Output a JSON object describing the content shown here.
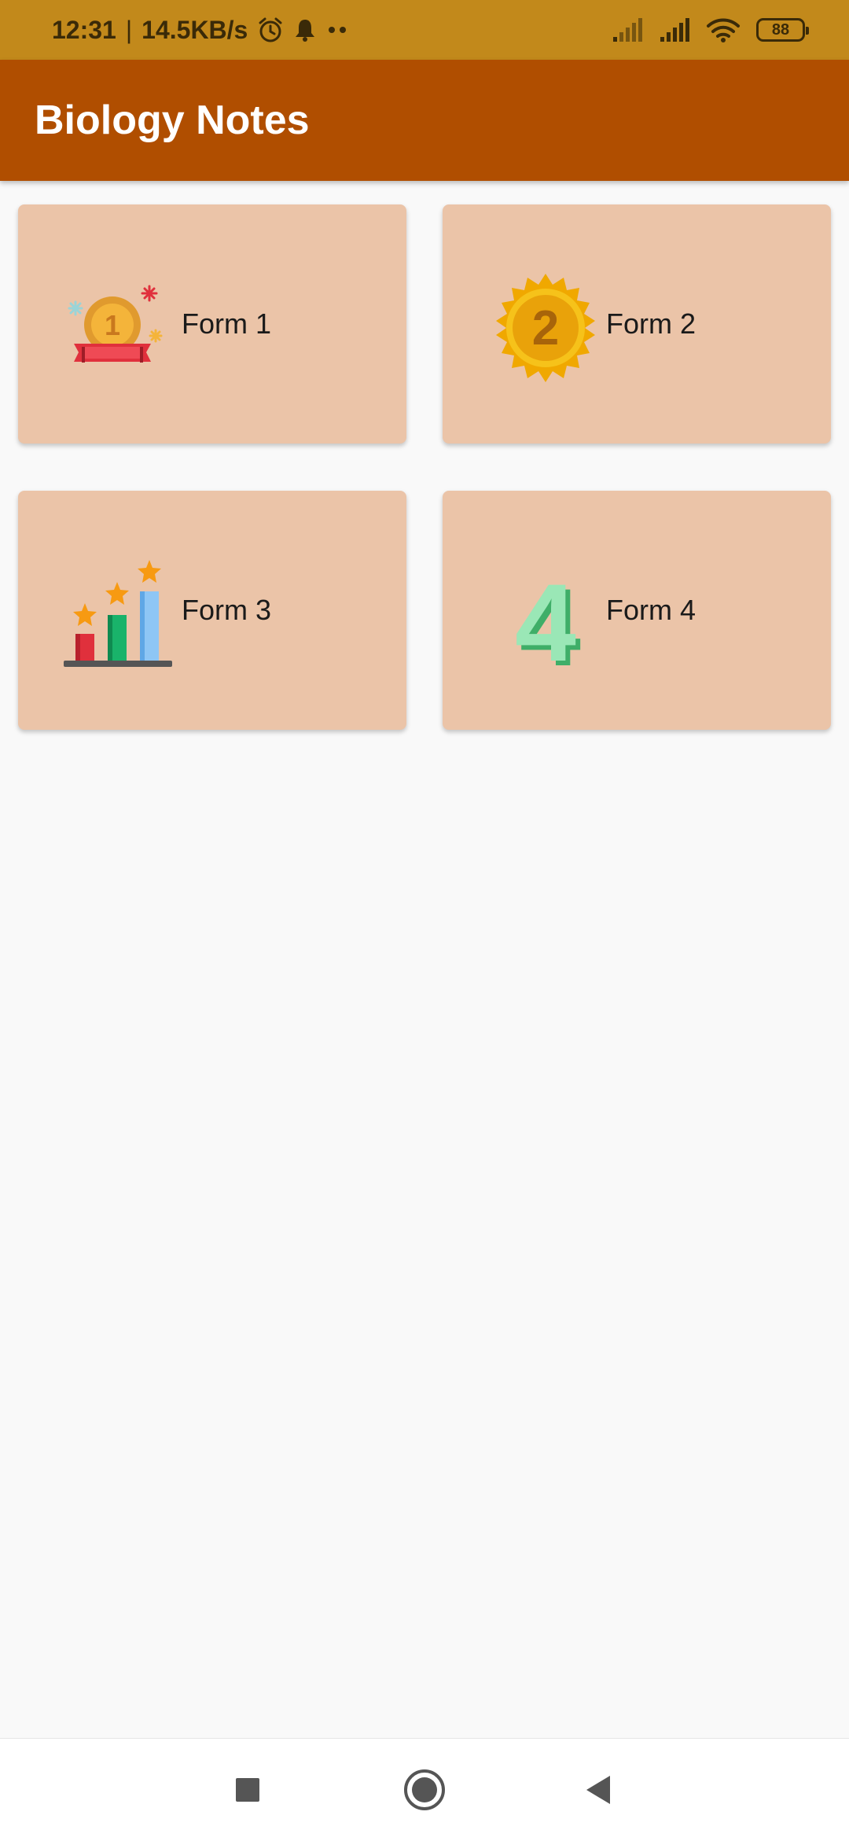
{
  "status_bar": {
    "time": "12:31",
    "separator": "|",
    "network_speed": "14.5KB/s",
    "battery_level": "88",
    "icons": [
      "alarm-icon",
      "notification-bell-icon",
      "more-dots-icon",
      "signal-icon",
      "signal-icon",
      "wifi-icon",
      "battery-icon"
    ]
  },
  "app_bar": {
    "title": "Biology Notes",
    "color": "#b04e00"
  },
  "cards": [
    {
      "label": "Form 1",
      "icon": "medal-1-icon"
    },
    {
      "label": "Form 2",
      "icon": "badge-2-icon"
    },
    {
      "label": "Form 3",
      "icon": "bar-chart-stars-icon"
    },
    {
      "label": "Form 4",
      "icon": "number-4-icon"
    }
  ],
  "nav_bar": {
    "icons": [
      "recents-square-icon",
      "home-circle-icon",
      "back-triangle-icon"
    ]
  },
  "colors": {
    "status_bar": "#c2891b",
    "card_background": "#ebc4a8",
    "page_background": "#f9f9f9"
  }
}
